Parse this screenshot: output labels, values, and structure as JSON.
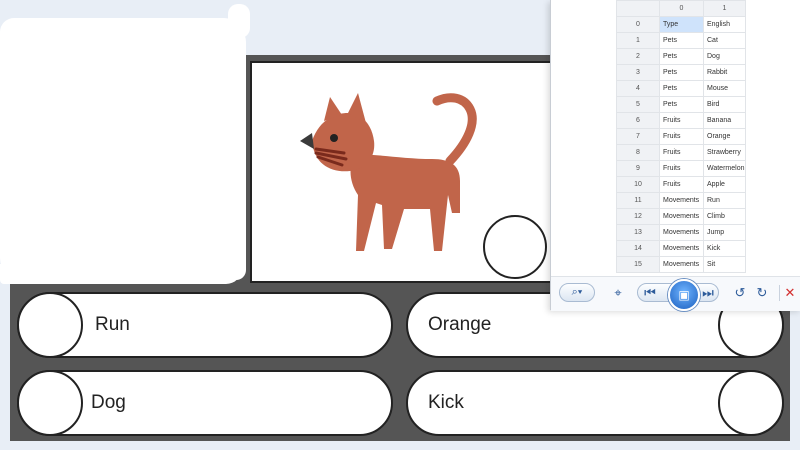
{
  "game": {
    "image_subject": "cat",
    "answers": [
      {
        "label": "Run",
        "bubble_side": "left"
      },
      {
        "label": "Orange",
        "bubble_side": "right"
      },
      {
        "label": "Dog",
        "bubble_side": "left"
      },
      {
        "label": "Kick",
        "bubble_side": "right"
      }
    ]
  },
  "viewer": {
    "columns": [
      "0",
      "1"
    ],
    "rows": [
      {
        "idx": "0",
        "c0": "Type",
        "c1": "English"
      },
      {
        "idx": "1",
        "c0": "Pets",
        "c1": "Cat"
      },
      {
        "idx": "2",
        "c0": "Pets",
        "c1": "Dog"
      },
      {
        "idx": "3",
        "c0": "Pets",
        "c1": "Rabbit"
      },
      {
        "idx": "4",
        "c0": "Pets",
        "c1": "Mouse"
      },
      {
        "idx": "5",
        "c0": "Pets",
        "c1": "Bird"
      },
      {
        "idx": "6",
        "c0": "Fruits",
        "c1": "Banana"
      },
      {
        "idx": "7",
        "c0": "Fruits",
        "c1": "Orange"
      },
      {
        "idx": "8",
        "c0": "Fruits",
        "c1": "Strawberry"
      },
      {
        "idx": "9",
        "c0": "Fruits",
        "c1": "Watermelon"
      },
      {
        "idx": "10",
        "c0": "Fruits",
        "c1": "Apple"
      },
      {
        "idx": "11",
        "c0": "Movements",
        "c1": "Run"
      },
      {
        "idx": "12",
        "c0": "Movements",
        "c1": "Climb"
      },
      {
        "idx": "13",
        "c0": "Movements",
        "c1": "Jump"
      },
      {
        "idx": "14",
        "c0": "Movements",
        "c1": "Kick"
      },
      {
        "idx": "15",
        "c0": "Movements",
        "c1": "Sit"
      }
    ],
    "toolbar": {
      "zoom_icon": "zoom-dropdown-icon",
      "fit_icon": "fit-to-window-icon",
      "prev_icon": "previous-icon",
      "slideshow_icon": "slideshow-icon",
      "next_icon": "next-icon",
      "rotate_ccw_icon": "rotate-counterclockwise-icon",
      "rotate_cw_icon": "rotate-clockwise-icon",
      "delete_icon": "delete-icon"
    }
  },
  "colors": {
    "board": "#555555",
    "cat": "#c1654a",
    "cat_dark": "#7a2a1c",
    "highlight_cell": "#cfe3fb",
    "delete": "#d32f2f"
  }
}
